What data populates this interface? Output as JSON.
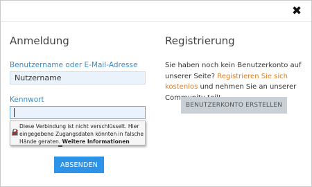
{
  "modal": {
    "close_glyph": "✖"
  },
  "login": {
    "title": "Anmeldung",
    "username_label": "Benutzername oder E-Mail-Adresse",
    "username_value": "Nutzername",
    "password_label": "Kennwort",
    "password_value": "",
    "submit_label": "ABSENDEN"
  },
  "warning_tooltip": {
    "icon": "insecure-lock-icon",
    "text": "Diese Verbindung ist nicht verschlüsselt. Hier eingegebene Zugangsdaten könnten in falsche Hände geraten.",
    "link": "Weitere Informationen"
  },
  "register": {
    "title": "Registrierung",
    "text_before": "Sie haben noch kein Benutzerkonto auf unserer Seite?",
    "link": "Registrieren Sie sich kostenlos",
    "text_after": "und nehmen Sie an unserer Community teil!",
    "button_label": "BENUTZERKONTO ERSTELLEN"
  },
  "colors": {
    "accent_blue": "#2c93e8",
    "label_blue": "#3a8dc8",
    "link_orange": "#e07d22",
    "input_bg": "#eaf3fb",
    "secondary_button": "#c9d0d6"
  }
}
